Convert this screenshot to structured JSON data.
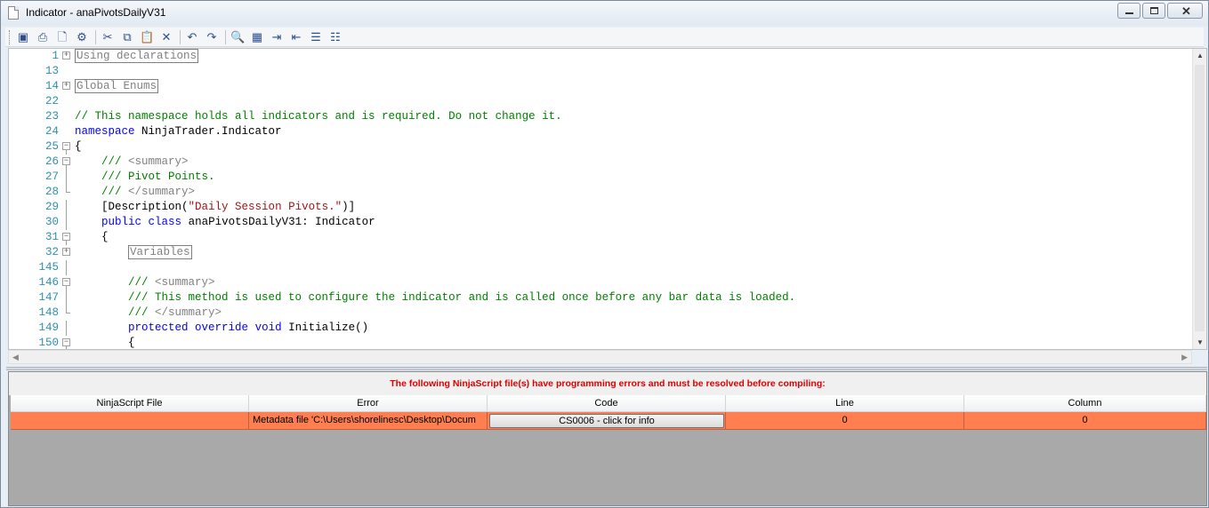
{
  "window": {
    "title": "Indicator - anaPivotsDailyV31",
    "close_glyph": "✕"
  },
  "toolbar": {
    "icons": [
      {
        "name": "save-icon",
        "glyph": "▣"
      },
      {
        "name": "print-icon",
        "glyph": "⎙"
      },
      {
        "name": "print-preview-icon",
        "glyph": "🗋"
      },
      {
        "name": "compile-icon",
        "glyph": "⚙"
      },
      {
        "name": "cut-icon",
        "glyph": "✂"
      },
      {
        "name": "copy-icon",
        "glyph": "⧉"
      },
      {
        "name": "paste-icon",
        "glyph": "📋"
      },
      {
        "name": "delete-icon",
        "glyph": "✕"
      },
      {
        "name": "undo-icon",
        "glyph": "↶"
      },
      {
        "name": "redo-icon",
        "glyph": "↷"
      },
      {
        "name": "find-icon",
        "glyph": "🔍"
      },
      {
        "name": "replace-icon",
        "glyph": "▦"
      },
      {
        "name": "indent-icon",
        "glyph": "⇥"
      },
      {
        "name": "outdent-icon",
        "glyph": "⇤"
      },
      {
        "name": "comment-icon",
        "glyph": "☰"
      },
      {
        "name": "uncomment-icon",
        "glyph": "☷"
      }
    ]
  },
  "editor": {
    "lines": [
      {
        "num": "1",
        "fold": "+",
        "indent": "",
        "parts": [
          {
            "cls": "region",
            "text": "Using declarations"
          }
        ]
      },
      {
        "num": "13",
        "fold": "",
        "indent": "",
        "parts": []
      },
      {
        "num": "14",
        "fold": "+",
        "indent": "",
        "parts": [
          {
            "cls": "region",
            "text": "Global Enums"
          }
        ]
      },
      {
        "num": "22",
        "fold": "",
        "indent": "",
        "parts": []
      },
      {
        "num": "23",
        "fold": "",
        "indent": "",
        "parts": [
          {
            "cls": "cm",
            "text": "// This namespace holds all indicators and is required. Do not change it."
          }
        ]
      },
      {
        "num": "24",
        "fold": "",
        "indent": "",
        "parts": [
          {
            "cls": "kw",
            "text": "namespace"
          },
          {
            "cls": "tx",
            "text": " NinjaTrader.Indicator"
          }
        ]
      },
      {
        "num": "25",
        "fold": "-",
        "indent": "",
        "parts": [
          {
            "cls": "tx",
            "text": "{"
          }
        ]
      },
      {
        "num": "26",
        "fold": "-",
        "indent": "    ",
        "parts": [
          {
            "cls": "cm",
            "text": "/// "
          },
          {
            "cls": "xml",
            "text": "<summary>"
          }
        ]
      },
      {
        "num": "27",
        "fold": "|",
        "indent": "    ",
        "parts": [
          {
            "cls": "cm",
            "text": "/// Pivot Points."
          }
        ]
      },
      {
        "num": "28",
        "fold": "L",
        "indent": "    ",
        "parts": [
          {
            "cls": "cm",
            "text": "/// "
          },
          {
            "cls": "xml",
            "text": "</summary>"
          }
        ]
      },
      {
        "num": "29",
        "fold": "|",
        "indent": "    ",
        "parts": [
          {
            "cls": "tx",
            "text": "[Description("
          },
          {
            "cls": "str",
            "text": "\"Daily Session Pivots.\""
          },
          {
            "cls": "tx",
            "text": ")]"
          }
        ]
      },
      {
        "num": "30",
        "fold": "|",
        "indent": "    ",
        "parts": [
          {
            "cls": "kw",
            "text": "public"
          },
          {
            "cls": "tx",
            "text": " "
          },
          {
            "cls": "kw",
            "text": "class"
          },
          {
            "cls": "tx",
            "text": " anaPivotsDailyV31: Indicator"
          }
        ]
      },
      {
        "num": "31",
        "fold": "-",
        "indent": "    ",
        "parts": [
          {
            "cls": "tx",
            "text": "{"
          }
        ]
      },
      {
        "num": "32",
        "fold": "+",
        "indent": "        ",
        "parts": [
          {
            "cls": "region",
            "text": "Variables"
          }
        ]
      },
      {
        "num": "145",
        "fold": "|",
        "indent": "",
        "parts": []
      },
      {
        "num": "146",
        "fold": "-",
        "indent": "        ",
        "parts": [
          {
            "cls": "cm",
            "text": "/// "
          },
          {
            "cls": "xml",
            "text": "<summary>"
          }
        ]
      },
      {
        "num": "147",
        "fold": "|",
        "indent": "        ",
        "parts": [
          {
            "cls": "cm",
            "text": "/// This method is used to configure the indicator and is called once before any bar data is loaded."
          }
        ]
      },
      {
        "num": "148",
        "fold": "L",
        "indent": "        ",
        "parts": [
          {
            "cls": "cm",
            "text": "/// "
          },
          {
            "cls": "xml",
            "text": "</summary>"
          }
        ]
      },
      {
        "num": "149",
        "fold": "|",
        "indent": "        ",
        "parts": [
          {
            "cls": "kw",
            "text": "protected"
          },
          {
            "cls": "tx",
            "text": " "
          },
          {
            "cls": "kw",
            "text": "override"
          },
          {
            "cls": "tx",
            "text": " "
          },
          {
            "cls": "kw",
            "text": "void"
          },
          {
            "cls": "tx",
            "text": " Initialize()"
          }
        ]
      },
      {
        "num": "150",
        "fold": "-",
        "indent": "        ",
        "parts": [
          {
            "cls": "tx",
            "text": "{"
          }
        ]
      }
    ]
  },
  "errors": {
    "message": "The following NinjaScript file(s) have programming errors and must be resolved before compiling:",
    "columns": [
      "NinjaScript File",
      "Error",
      "Code",
      "Line",
      "Column"
    ],
    "rows": [
      {
        "file": "",
        "error": "Metadata file 'C:\\Users\\shorelinesc\\Desktop\\Docum",
        "code": "CS0006 - click for info",
        "line": "0",
        "column": "0"
      }
    ]
  }
}
